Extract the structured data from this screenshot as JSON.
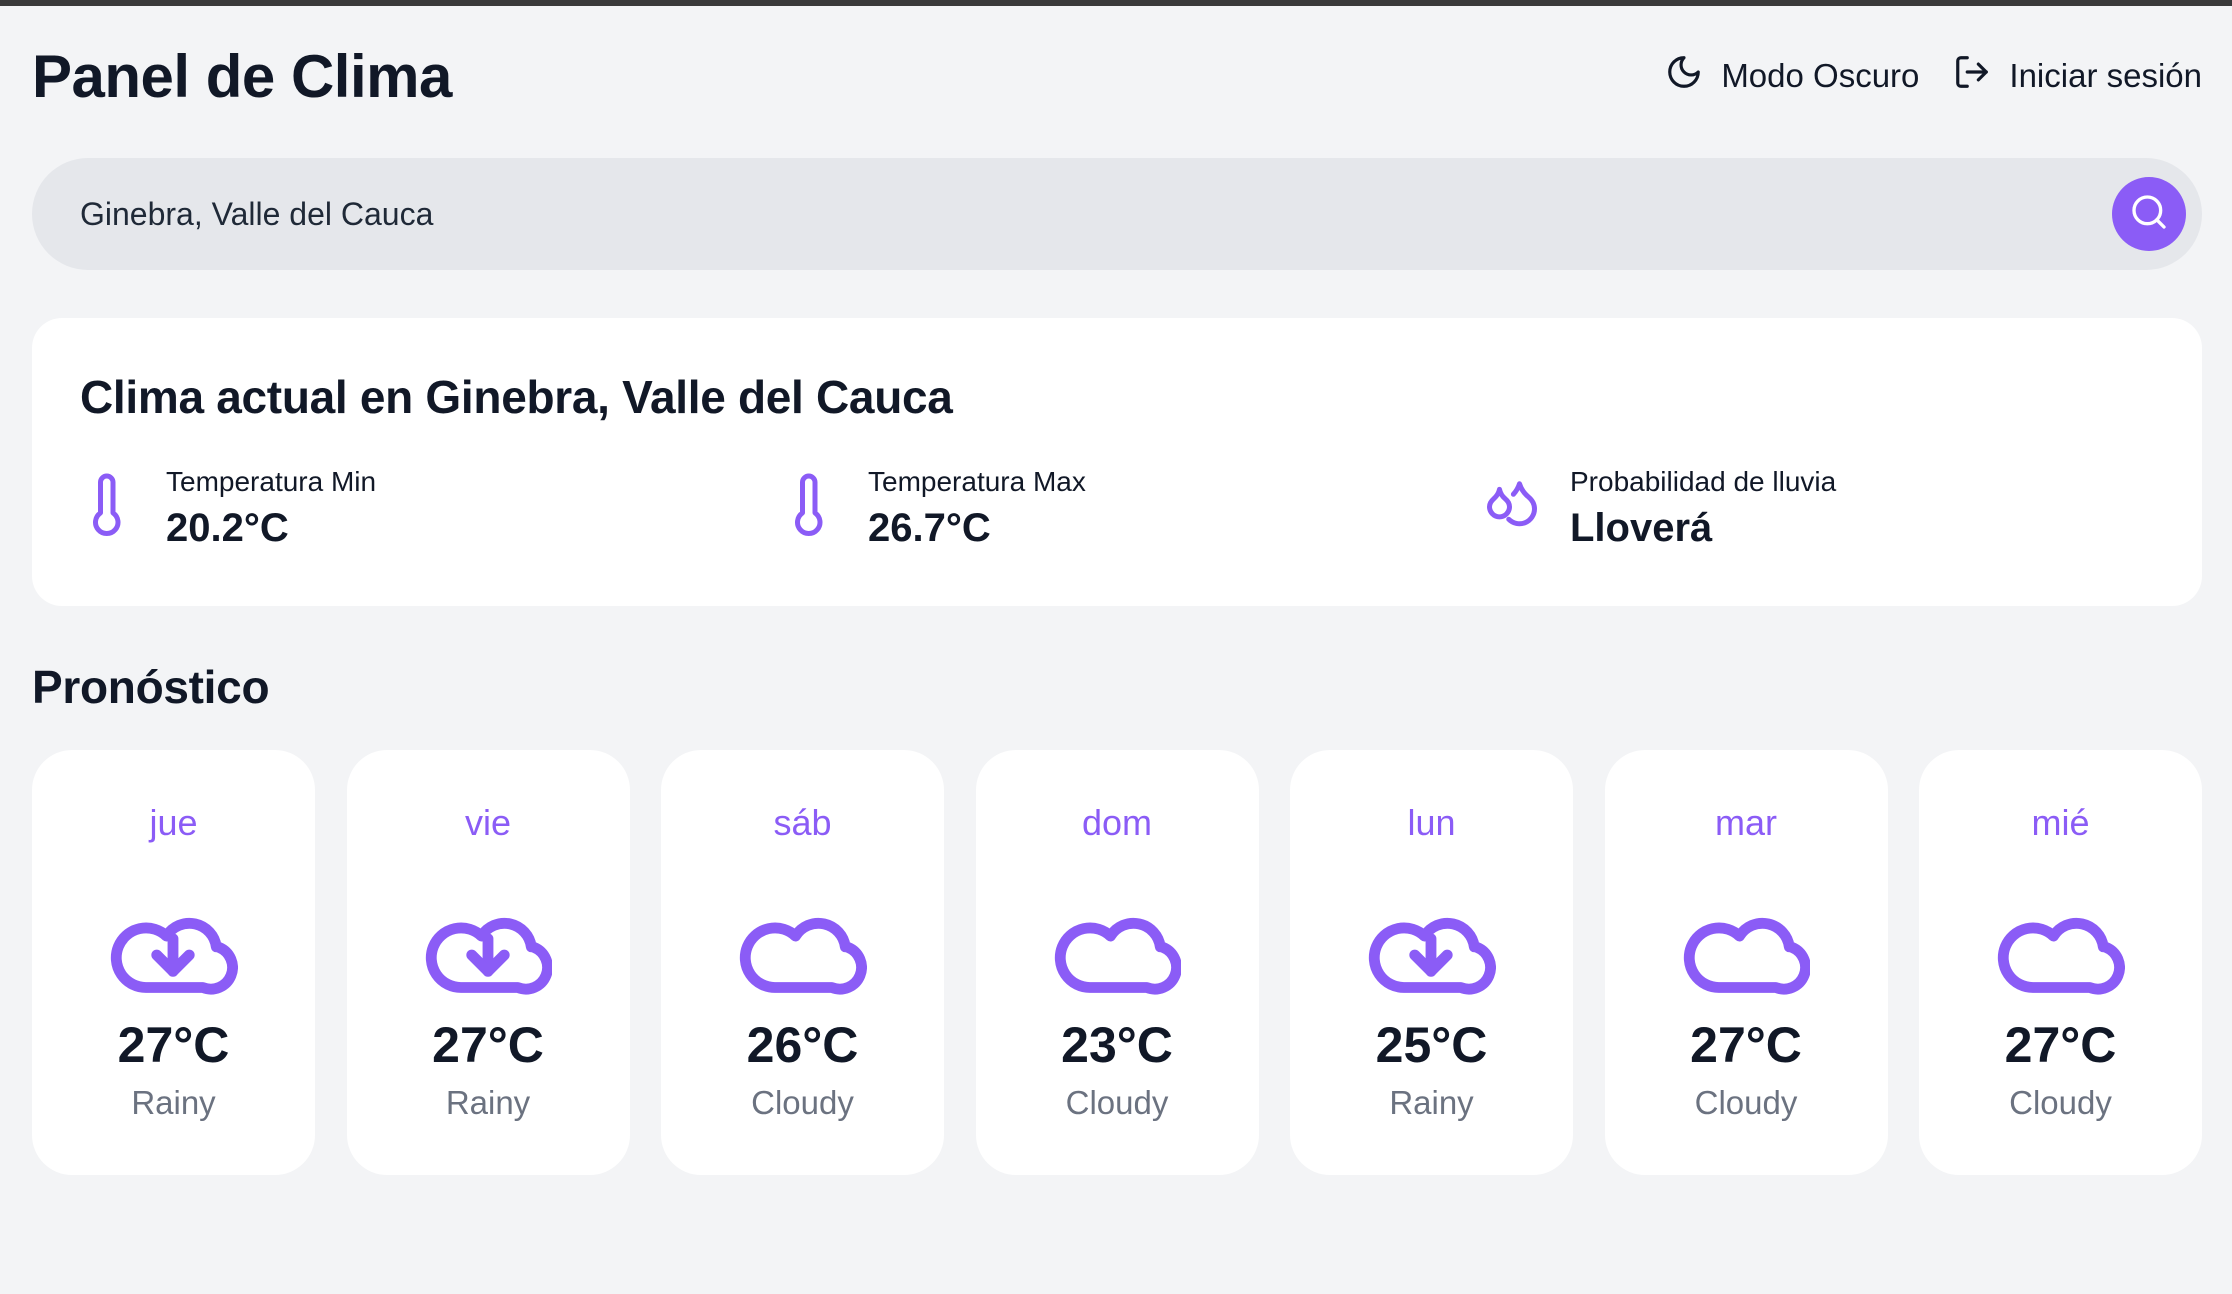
{
  "header": {
    "title": "Panel de Clima",
    "dark_mode_label": "Modo Oscuro",
    "login_label": "Iniciar sesión"
  },
  "search": {
    "value": "Ginebra, Valle del Cauca"
  },
  "current": {
    "title": "Clima actual en Ginebra, Valle del Cauca",
    "min_label": "Temperatura Min",
    "min_value": "20.2°C",
    "max_label": "Temperatura Max",
    "max_value": "26.7°C",
    "rain_label": "Probabilidad de lluvia",
    "rain_value": "Lloverá"
  },
  "forecast": {
    "title": "Pronóstico",
    "days": [
      {
        "day": "jue",
        "temp": "27°C",
        "condition": "Rainy",
        "icon": "cloud-download-icon"
      },
      {
        "day": "vie",
        "temp": "27°C",
        "condition": "Rainy",
        "icon": "cloud-download-icon"
      },
      {
        "day": "sáb",
        "temp": "26°C",
        "condition": "Cloudy",
        "icon": "cloud-icon"
      },
      {
        "day": "dom",
        "temp": "23°C",
        "condition": "Cloudy",
        "icon": "cloud-icon"
      },
      {
        "day": "lun",
        "temp": "25°C",
        "condition": "Rainy",
        "icon": "cloud-download-icon"
      },
      {
        "day": "mar",
        "temp": "27°C",
        "condition": "Cloudy",
        "icon": "cloud-icon"
      },
      {
        "day": "mié",
        "temp": "27°C",
        "condition": "Cloudy",
        "icon": "cloud-icon"
      }
    ]
  },
  "colors": {
    "accent": "#8b5cf6",
    "background": "#f3f4f6",
    "card": "#ffffff",
    "search_bg": "#e5e7eb"
  }
}
